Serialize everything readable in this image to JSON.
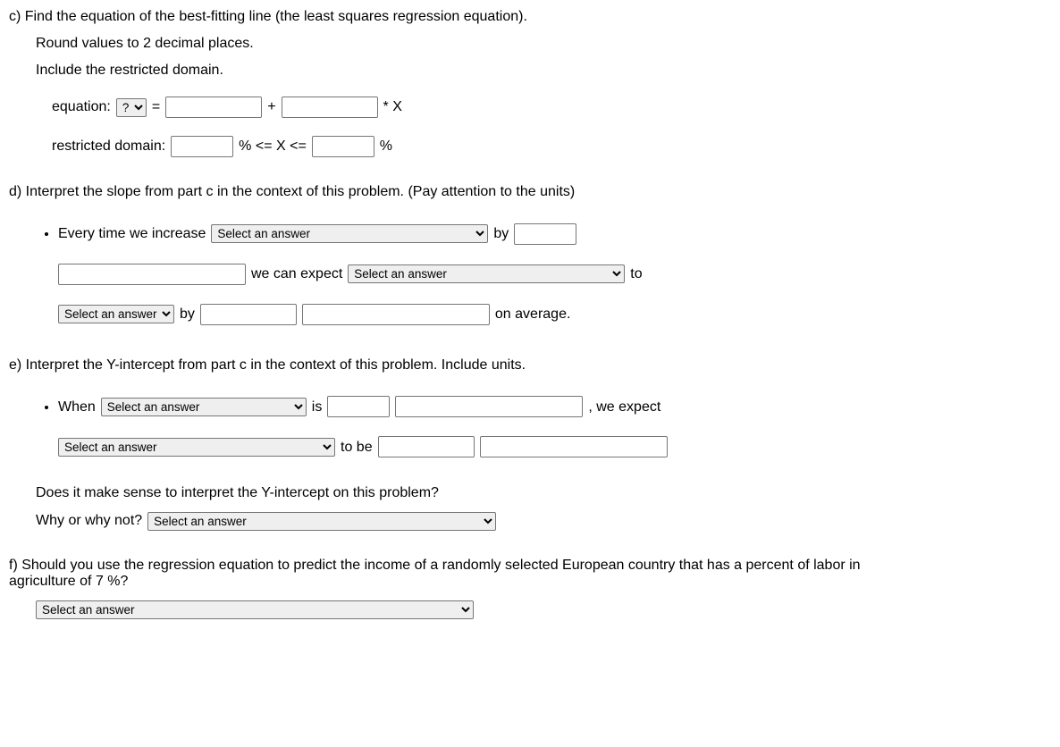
{
  "c": {
    "title": "c) Find the equation of the best-fitting line (the least squares regression equation).",
    "round": "Round values to 2 decimal places.",
    "include": "Include the restricted domain.",
    "eq_label": "equation:",
    "select_q": "?",
    "equals": "=",
    "plus": "+",
    "times_x": "* X",
    "domain_label": "restricted domain:",
    "pct_le": "% <= X <=",
    "pct": "%"
  },
  "d": {
    "title": "d) Interpret the slope from part c in the context of this problem. (Pay attention to the units)",
    "bullet1": "Every time we increase",
    "sel_ans": "Select an answer",
    "by": "by",
    "we_expect": "we can expect",
    "to": "to",
    "by2": "by",
    "on_avg": "on average."
  },
  "e": {
    "title": "e) Interpret the Y-intercept from part c in the context of this problem. Include units.",
    "when": "When",
    "sel_ans": "Select an answer",
    "is": "is",
    "we_expect": ", we expect",
    "to_be": "to be",
    "does_sense": "Does it make sense to interpret the Y-intercept on this problem?",
    "why": "Why or why not?"
  },
  "f": {
    "title": "f) Should you use the regression equation to predict the income of a randomly selected European country that has a percent of labor in agriculture of 7 %?",
    "sel_ans": "Select an answer"
  }
}
